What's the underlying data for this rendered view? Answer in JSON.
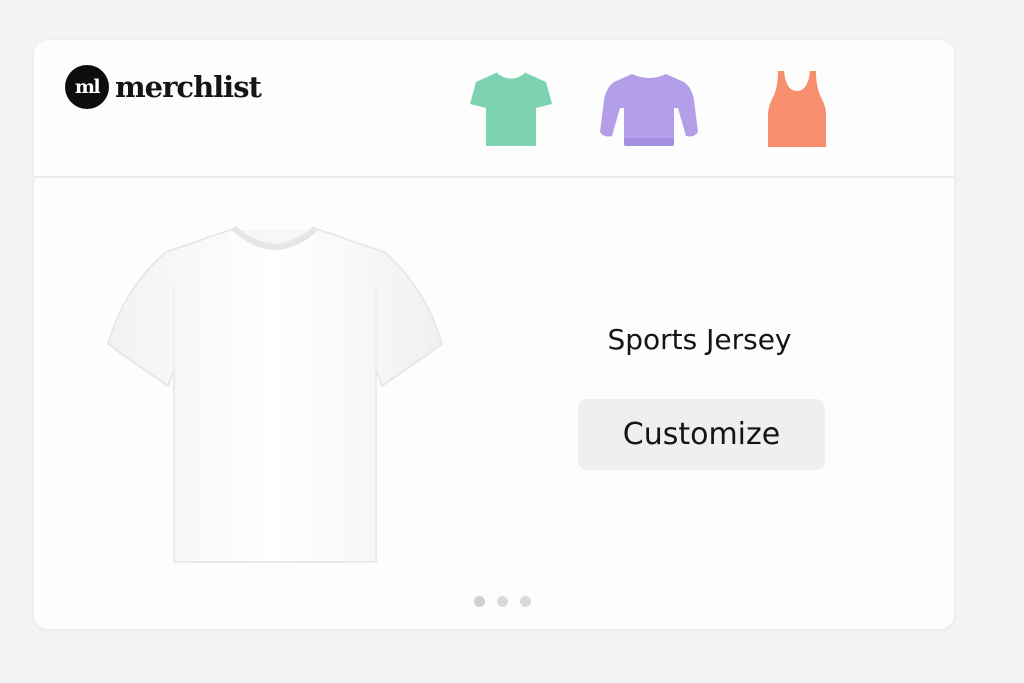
{
  "brand": {
    "mark": "ml",
    "name": "merchlist"
  },
  "categories": [
    {
      "name": "t-shirt",
      "icon": "tshirt-icon",
      "color": "#7dd3b0"
    },
    {
      "name": "sweatshirt",
      "icon": "sweatshirt-icon",
      "color": "#b39ee8"
    },
    {
      "name": "tank top",
      "icon": "tanktop-icon",
      "color": "#f88e6e"
    }
  ],
  "product": {
    "name": "Sports Jersey",
    "image_icon": "white-tshirt-image",
    "cta_label": "Customize"
  },
  "carousel": {
    "slides": 3,
    "active_index": 0
  }
}
